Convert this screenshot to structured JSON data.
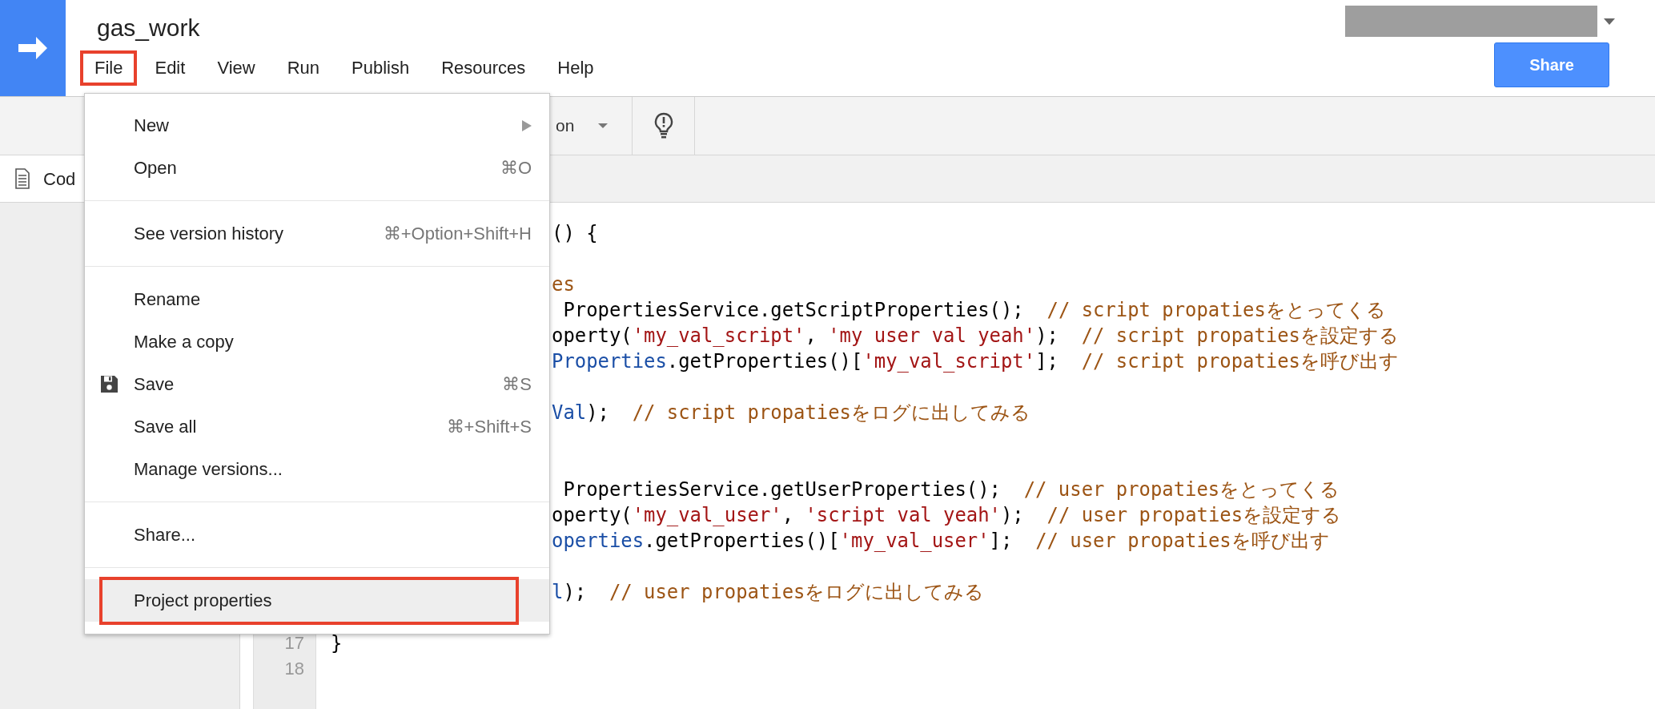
{
  "header": {
    "title": "gas_work",
    "share_button": "Share"
  },
  "menubar": [
    {
      "label": "File",
      "annotated": true
    },
    {
      "label": "Edit",
      "annotated": false
    },
    {
      "label": "View",
      "annotated": false
    },
    {
      "label": "Run",
      "annotated": false
    },
    {
      "label": "Publish",
      "annotated": false
    },
    {
      "label": "Resources",
      "annotated": false
    },
    {
      "label": "Help",
      "annotated": false
    }
  ],
  "toolbar": {
    "function_select": "on"
  },
  "file_tab": {
    "label": "Cod"
  },
  "file_menu": [
    {
      "kind": "item",
      "label": "New",
      "submenu": true,
      "hovered": false,
      "annotated": false
    },
    {
      "kind": "item",
      "label": "Open",
      "shortcut": "⌘O",
      "submenu": false,
      "hovered": false,
      "annotated": false
    },
    {
      "kind": "separator"
    },
    {
      "kind": "item",
      "label": "See version history",
      "shortcut": "⌘+Option+Shift+H",
      "submenu": false,
      "hovered": false,
      "annotated": false
    },
    {
      "kind": "separator"
    },
    {
      "kind": "item",
      "label": "Rename",
      "submenu": false,
      "hovered": false,
      "annotated": false
    },
    {
      "kind": "item",
      "label": "Make a copy",
      "submenu": false,
      "hovered": false,
      "annotated": false
    },
    {
      "kind": "icon_item",
      "label": "Save",
      "shortcut": "⌘S",
      "submenu": false,
      "hovered": false,
      "annotated": false
    },
    {
      "kind": "item",
      "label": "Save all",
      "shortcut": "⌘+Shift+S",
      "submenu": false,
      "hovered": false,
      "annotated": false
    },
    {
      "kind": "item",
      "label": "Manage versions...",
      "submenu": false,
      "hovered": false,
      "annotated": false
    },
    {
      "kind": "separator"
    },
    {
      "kind": "item",
      "label": "Share...",
      "submenu": false,
      "hovered": false,
      "annotated": false
    },
    {
      "kind": "separator"
    },
    {
      "kind": "item",
      "label": "Project properties",
      "submenu": false,
      "hovered": true,
      "annotated": true
    }
  ],
  "code": {
    "lines": [
      {
        "kind": "clipped",
        "segments": [
          {
            "kind": "plain",
            "text": "() {"
          }
        ]
      },
      {
        "kind": "blank"
      },
      {
        "kind": "clipped",
        "segments": [
          {
            "kind": "comment",
            "text": "es"
          }
        ]
      },
      {
        "kind": "clipped",
        "segments": [
          {
            "kind": "plain",
            "text": " PropertiesService.getScriptProperties();  "
          },
          {
            "kind": "comment",
            "text": "// script propatiesをとってくる"
          }
        ]
      },
      {
        "kind": "clipped",
        "segments": [
          {
            "kind": "plain",
            "text": "operty("
          },
          {
            "kind": "string",
            "text": "'my_val_script'"
          },
          {
            "kind": "plain",
            "text": ", "
          },
          {
            "kind": "string",
            "text": "'my user val yeah'"
          },
          {
            "kind": "plain",
            "text": ");  "
          },
          {
            "kind": "comment",
            "text": "// script propatiesを設定する"
          }
        ]
      },
      {
        "kind": "clipped",
        "segments": [
          {
            "kind": "ident",
            "text": "Properties"
          },
          {
            "kind": "plain",
            "text": ".getProperties()["
          },
          {
            "kind": "string",
            "text": "'my_val_script'"
          },
          {
            "kind": "plain",
            "text": "];  "
          },
          {
            "kind": "comment",
            "text": "// script propatiesを呼び出す"
          }
        ]
      },
      {
        "kind": "blank"
      },
      {
        "kind": "clipped",
        "segments": [
          {
            "kind": "ident",
            "text": "Val"
          },
          {
            "kind": "plain",
            "text": ");  "
          },
          {
            "kind": "comment",
            "text": "// script propatiesをログに出してみる"
          }
        ]
      },
      {
        "kind": "blank"
      },
      {
        "kind": "blank"
      },
      {
        "kind": "clipped",
        "segments": [
          {
            "kind": "plain",
            "text": " PropertiesService.getUserProperties();  "
          },
          {
            "kind": "comment",
            "text": "// user propatiesをとってくる"
          }
        ]
      },
      {
        "kind": "clipped",
        "segments": [
          {
            "kind": "plain",
            "text": "operty("
          },
          {
            "kind": "string",
            "text": "'my_val_user'"
          },
          {
            "kind": "plain",
            "text": ", "
          },
          {
            "kind": "string",
            "text": "'script val yeah'"
          },
          {
            "kind": "plain",
            "text": ");  "
          },
          {
            "kind": "comment",
            "text": "// user propatiesを設定する"
          }
        ]
      },
      {
        "kind": "clipped",
        "segments": [
          {
            "kind": "ident",
            "text": "operties"
          },
          {
            "kind": "plain",
            "text": ".getProperties()["
          },
          {
            "kind": "string",
            "text": "'my_val_user'"
          },
          {
            "kind": "plain",
            "text": "];  "
          },
          {
            "kind": "comment",
            "text": "// user propatiesを呼び出す"
          }
        ]
      },
      {
        "kind": "blank"
      },
      {
        "kind": "clipped",
        "segments": [
          {
            "kind": "ident",
            "text": "l"
          },
          {
            "kind": "plain",
            "text": ");  "
          },
          {
            "kind": "comment",
            "text": "// user propatiesをログに出してみる"
          }
        ]
      },
      {
        "kind": "blank"
      },
      {
        "kind": "full",
        "number": "17",
        "segments": [
          {
            "kind": "plain",
            "text": "}"
          }
        ]
      },
      {
        "kind": "full",
        "number": "18"
      }
    ]
  }
}
